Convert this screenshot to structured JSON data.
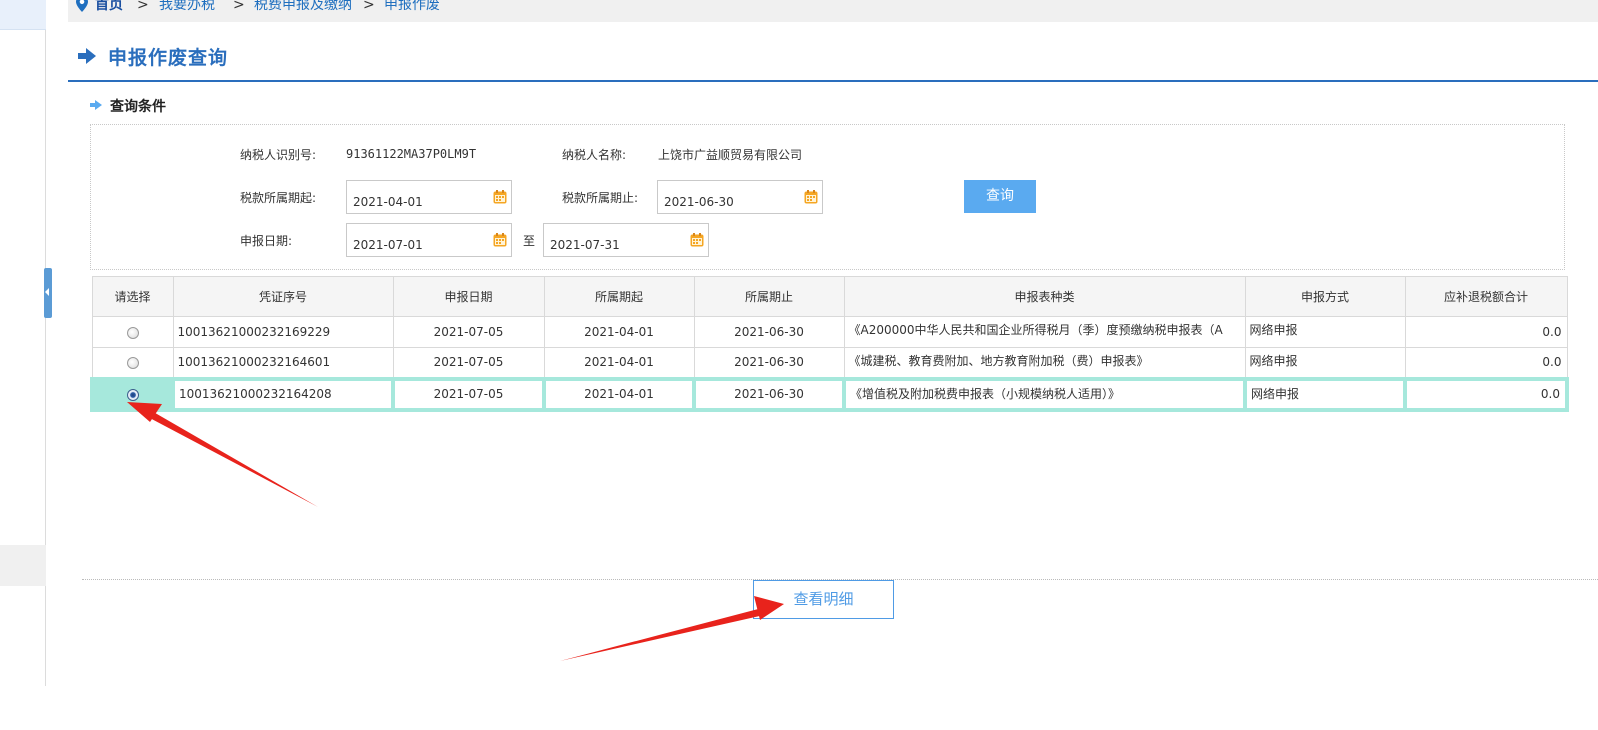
{
  "breadcrumb": {
    "items": [
      "首页",
      "我要办税",
      "税费申报及缴纳",
      "申报作废"
    ],
    "separator": ">"
  },
  "page": {
    "title": "申报作废查询",
    "section_title": "查询条件"
  },
  "query": {
    "taxpayer_id_label": "纳税人识别号:",
    "taxpayer_id_value": "91361122MA37P0LM9T",
    "taxpayer_name_label": "纳税人名称:",
    "taxpayer_name_value": "上饶市广益顺贸易有限公司",
    "period_start_label": "税款所属期起:",
    "period_start_value": "2021-04-01",
    "period_end_label": "税款所属期止:",
    "period_end_value": "2021-06-30",
    "declare_date_label": "申报日期:",
    "declare_date_from": "2021-07-01",
    "to_label": "至",
    "declare_date_to": "2021-07-31",
    "query_button": "查询"
  },
  "table": {
    "headers": [
      "请选择",
      "凭证序号",
      "申报日期",
      "所属期起",
      "所属期止",
      "申报表种类",
      "申报方式",
      "应补退税额合计"
    ],
    "rows": [
      {
        "selected": false,
        "voucher": "10013621000232169229",
        "declare_date": "2021-07-05",
        "period_start": "2021-04-01",
        "period_end": "2021-06-30",
        "form_type": "《A200000中华人民共和国企业所得税月（季）度预缴纳税申报表（A",
        "method": "网络申报",
        "amount": "0.0"
      },
      {
        "selected": false,
        "voucher": "10013621000232164601",
        "declare_date": "2021-07-05",
        "period_start": "2021-04-01",
        "period_end": "2021-06-30",
        "form_type": "《城建税、教育费附加、地方教育附加税（费）申报表》",
        "method": "网络申报",
        "amount": "0.0"
      },
      {
        "selected": true,
        "voucher": "10013621000232164208",
        "declare_date": "2021-07-05",
        "period_start": "2021-04-01",
        "period_end": "2021-06-30",
        "form_type": "《增值税及附加税费申报表（小规模纳税人适用）》",
        "method": "网络申报",
        "amount": "0.0"
      }
    ]
  },
  "actions": {
    "view_detail": "查看明细"
  },
  "colors": {
    "primary_blue": "#2a6ebd",
    "button_blue": "#5aaaf0",
    "selected_row": "#a6e8dc",
    "annotation_red": "#e8231c",
    "calendar_orange": "#f5a623"
  }
}
